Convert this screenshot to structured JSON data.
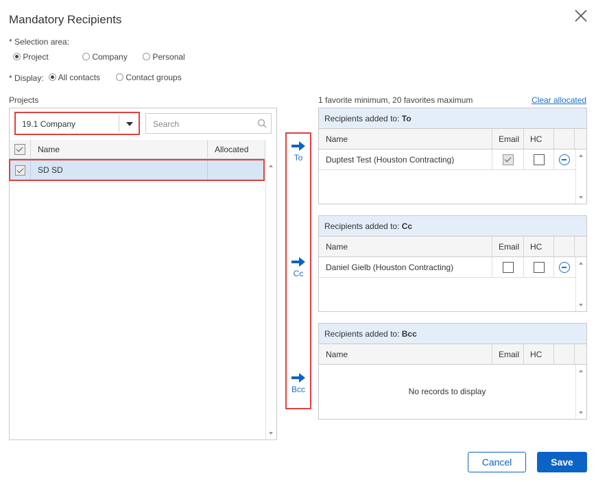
{
  "dialog": {
    "title": "Mandatory Recipients"
  },
  "selection": {
    "label": "* Selection area:",
    "options": [
      "Project",
      "Company",
      "Personal"
    ],
    "selected": "Project"
  },
  "display": {
    "label": "* Display:",
    "options": [
      "All contacts",
      "Contact groups"
    ],
    "selected": "All contacts"
  },
  "projects": {
    "label": "Projects",
    "dropdown_value": "19.1 Company",
    "search_placeholder": "Search",
    "columns": [
      "Name",
      "Allocated"
    ],
    "rows": [
      {
        "name": "SD SD",
        "allocated": "",
        "checked": true
      }
    ]
  },
  "transfer": {
    "to": "To",
    "cc": "Cc",
    "bcc": "Bcc"
  },
  "favorites_note": "1 favorite minimum, 20 favorites maximum",
  "clear_allocated": "Clear allocated",
  "recipients": {
    "header_prefix": "Recipients added to:",
    "columns": [
      "Name",
      "Email",
      "HC"
    ],
    "to": {
      "label": "To",
      "rows": [
        {
          "name": "Duptest Test (Houston Contracting)",
          "email": true,
          "hc": false
        }
      ]
    },
    "cc": {
      "label": "Cc",
      "rows": [
        {
          "name": "Daniel Gielb (Houston Contracting)",
          "email": false,
          "hc": false
        }
      ]
    },
    "bcc": {
      "label": "Bcc",
      "rows": [],
      "empty_text": "No records to display"
    }
  },
  "footer": {
    "cancel": "Cancel",
    "save": "Save"
  },
  "colors": {
    "accent": "#0b63c5",
    "highlight": "#e04040",
    "selected_row": "#d6e6f5"
  }
}
